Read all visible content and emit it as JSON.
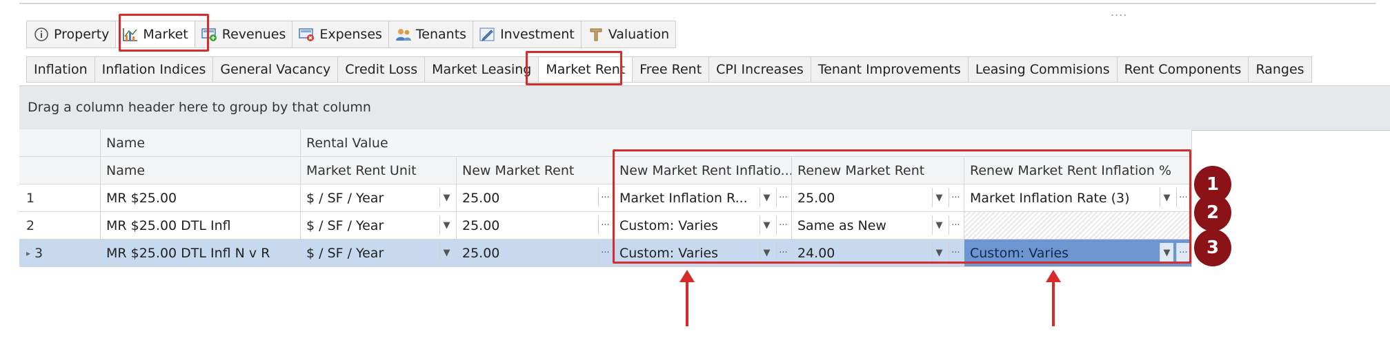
{
  "toolbar": {
    "dots": "...."
  },
  "main_tabs": [
    {
      "label": "Property",
      "icon": "info-icon"
    },
    {
      "label": "Market",
      "icon": "chart-icon"
    },
    {
      "label": "Revenues",
      "icon": "revenues-icon"
    },
    {
      "label": "Expenses",
      "icon": "expenses-icon"
    },
    {
      "label": "Tenants",
      "icon": "people-icon"
    },
    {
      "label": "Investment",
      "icon": "pencil-chart-icon"
    },
    {
      "label": "Valuation",
      "icon": "tool-icon"
    }
  ],
  "sub_tabs": [
    "Inflation",
    "Inflation Indices",
    "General Vacancy",
    "Credit Loss",
    "Market Leasing",
    "Market Rent",
    "Free Rent",
    "CPI Increases",
    "Tenant Improvements",
    "Leasing Commisions",
    "Rent Components",
    "Ranges"
  ],
  "active_main_tab": "Market",
  "active_sub_tab": "Market Rent",
  "group_panel_text": "Drag a column header here to group by that column",
  "grid": {
    "band_headers": {
      "name": "Name",
      "rental_value": "Rental Value"
    },
    "columns": [
      "Name",
      "Market Rent Unit",
      "New Market Rent",
      "New Market Rent Inflatio...",
      "Renew Market Rent",
      "Renew Market Rent Inflation %"
    ],
    "rows": [
      {
        "num": "1",
        "name": "MR $25.00",
        "unit": "$ / SF / Year",
        "new_rent": "25.00",
        "new_infl": "Market Inflation R...",
        "renew_rent": "25.00",
        "renew_infl": "Market Inflation Rate (3)"
      },
      {
        "num": "2",
        "name": "MR $25.00 DTL Infl",
        "unit": "$ / SF / Year",
        "new_rent": "25.00",
        "new_infl": "Custom: Varies",
        "renew_rent": "Same as New",
        "renew_infl": ""
      },
      {
        "num": "3",
        "name": "MR $25.00 DTL Infl N v R",
        "unit": "$ / SF / Year",
        "new_rent": "25.00",
        "new_infl": "Custom: Varies",
        "renew_rent": "24.00",
        "renew_infl": "Custom: Varies"
      }
    ],
    "row_indicator": "▸"
  },
  "badges": [
    "1",
    "2",
    "3"
  ],
  "colors": {
    "highlight": "#d62b2b",
    "badge": "#8b1318",
    "selected_row": "#c7d9ee",
    "focused_cell": "#6d95cf"
  }
}
